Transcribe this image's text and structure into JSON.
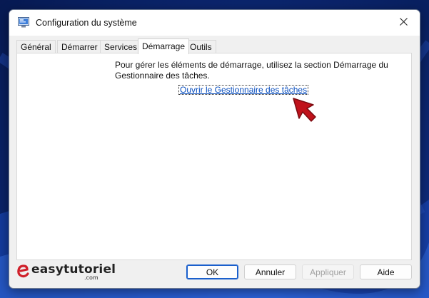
{
  "window": {
    "title": "Configuration du système",
    "close_symbol": "✕"
  },
  "tabs": [
    {
      "label": "Général",
      "active": false
    },
    {
      "label": "Démarrer",
      "active": false
    },
    {
      "label": "Services",
      "active": false
    },
    {
      "label": "Démarrage",
      "active": true
    },
    {
      "label": "Outils",
      "active": false
    }
  ],
  "panel": {
    "description": "Pour gérer les éléments de démarrage, utilisez la section Démarrage du Gestionnaire des tâches.",
    "link_text": "Ouvrir le Gestionnaire des tâches"
  },
  "buttons": {
    "ok": "OK",
    "cancel": "Annuler",
    "apply": "Appliquer",
    "help": "Aide"
  },
  "watermark": {
    "brand_text": "easytutoriel",
    "brand_sub": ".com"
  },
  "colors": {
    "link": "#0a4fbf",
    "default_button_border": "#1a5fcc",
    "cursor": "#c0121b",
    "brand_accent": "#d0202a"
  },
  "icons": {
    "app": "msconfig-icon",
    "close": "close-icon",
    "cursor": "arrow-cursor-icon"
  }
}
